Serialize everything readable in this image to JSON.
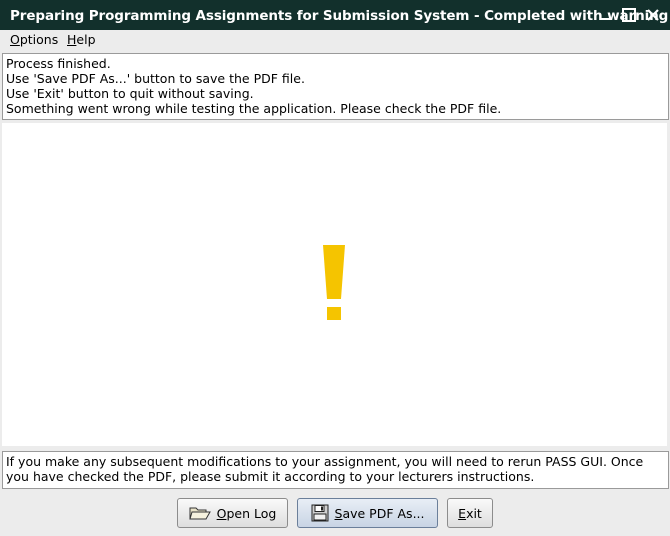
{
  "window": {
    "title": "Preparing Programming Assignments for Submission System - Completed with warning"
  },
  "menu": {
    "options": {
      "mnemonic": "O",
      "rest": "ptions"
    },
    "help": {
      "mnemonic": "H",
      "rest": "elp"
    }
  },
  "info": {
    "lines": [
      "Process finished.",
      "Use 'Save PDF As...' button to save the PDF file.",
      "Use 'Exit' button to quit without saving.",
      "Something went wrong while testing the application. Please check the PDF file."
    ]
  },
  "status_glyph": "!",
  "colors": {
    "title_bar": "#12302c",
    "warning": "#f5c400"
  },
  "notice": {
    "text": "If you make any subsequent modifications to your assignment, you will need to rerun PASS GUI. Once you have checked the PDF, please submit it according to your lecturers instructions."
  },
  "buttons": {
    "open_log": {
      "mnemonic": "O",
      "rest": "pen Log"
    },
    "save_pdf": {
      "mnemonic": "S",
      "rest": "ave PDF As..."
    },
    "exit": {
      "mnemonic": "E",
      "rest": "xit"
    }
  }
}
